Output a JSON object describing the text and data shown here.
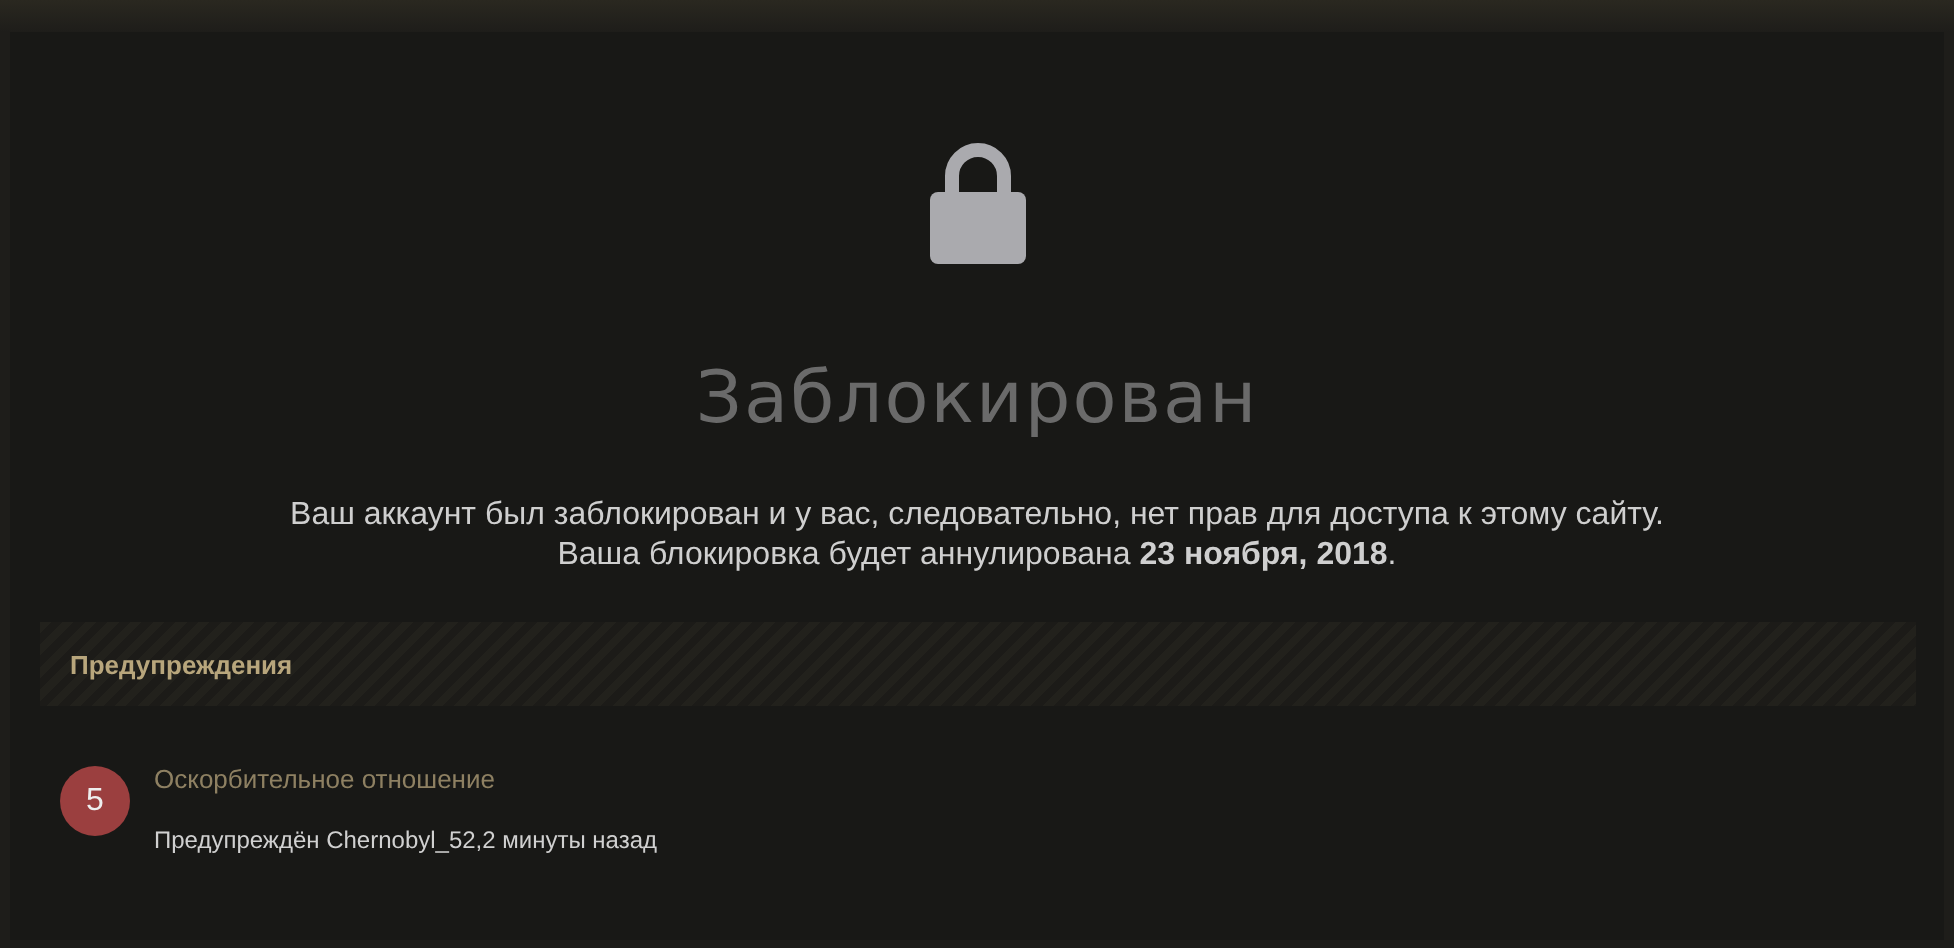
{
  "title": "Заблокирован",
  "message": [
    "Ваш аккаунт был заблокирован и у вас, следовательно, нет прав для доступа к этому сайту.",
    "Ваша блокировка будет аннулирована **23 ноября, 2018**."
  ],
  "warnings": {
    "title": "Предупреждения",
    "items": [
      {
        "points": "5",
        "reason": "Оскорбительное отношение",
        "detail": "Предупреждён Chernobyl_52,2 минуты назад"
      }
    ]
  }
}
